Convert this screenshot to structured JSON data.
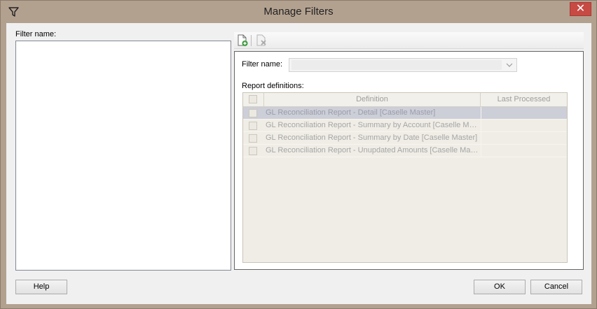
{
  "window": {
    "title": "Manage Filters",
    "close_label": "✕",
    "title_icon": "filter-icon"
  },
  "left": {
    "filter_name_label": "Filter name:",
    "items": []
  },
  "toolbar": {
    "new_icon": "new-document-icon",
    "delete_icon": "delete-document-icon"
  },
  "editor": {
    "filter_name_label": "Filter name:",
    "filter_name_value": "",
    "report_definitions_label": "Report definitions:",
    "columns": [
      "Definition",
      "Last Processed"
    ],
    "rows": [
      {
        "definition": "GL Reconciliation Report - Detail [Caselle Master]",
        "last_processed": "",
        "selected": true
      },
      {
        "definition": "GL Reconciliation Report - Summary by Account [Caselle Mas...",
        "last_processed": "",
        "selected": false
      },
      {
        "definition": "GL Reconciliation Report - Summary by Date [Caselle Master]",
        "last_processed": "",
        "selected": false
      },
      {
        "definition": "GL Reconciliation Report - Unupdated Amounts [Caselle Mast...",
        "last_processed": "",
        "selected": false
      }
    ]
  },
  "buttons": {
    "help": "Help",
    "ok": "OK",
    "cancel": "Cancel"
  },
  "colors": {
    "frame": "#b3a190",
    "close": "#c74a43",
    "selected_row": "#ccced8"
  }
}
